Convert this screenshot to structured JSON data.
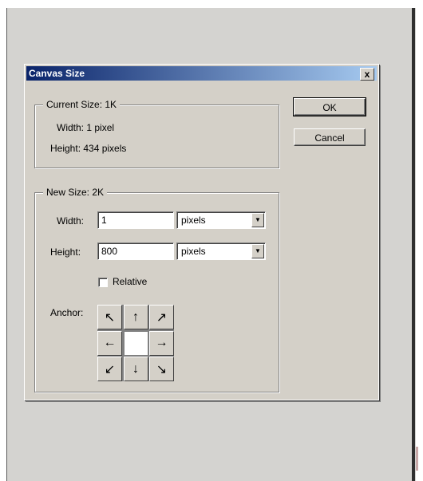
{
  "dialog": {
    "title": "Canvas Size",
    "close_label": "x"
  },
  "current_size": {
    "legend": "Current Size:  1K",
    "width_text": "Width:  1 pixel",
    "height_text": "Height:  434 pixels"
  },
  "new_size": {
    "legend": "New Size:  2K",
    "width_label": "Width:",
    "width_value": "1",
    "width_unit": "pixels",
    "height_label": "Height:",
    "height_value": "800",
    "height_unit": "pixels",
    "relative_label": "Relative",
    "relative_checked": false,
    "anchor_label": "Anchor:",
    "anchor_cells": [
      {
        "name": "anchor-top-left",
        "glyph": "↖"
      },
      {
        "name": "anchor-top",
        "glyph": "↑"
      },
      {
        "name": "anchor-top-right",
        "glyph": "↗"
      },
      {
        "name": "anchor-left",
        "glyph": "←"
      },
      {
        "name": "anchor-center",
        "glyph": ""
      },
      {
        "name": "anchor-right",
        "glyph": "→"
      },
      {
        "name": "anchor-bottom-left",
        "glyph": "↙"
      },
      {
        "name": "anchor-bottom",
        "glyph": "↓"
      },
      {
        "name": "anchor-bottom-right",
        "glyph": "↘"
      }
    ]
  },
  "buttons": {
    "ok": "OK",
    "cancel": "Cancel"
  },
  "icons": {
    "dropdown": "chevron-down-icon",
    "close": "close-icon"
  },
  "colors": {
    "title_start": "#0a246a",
    "title_end": "#a6caf0",
    "dialog_face": "#d4d0c8"
  }
}
